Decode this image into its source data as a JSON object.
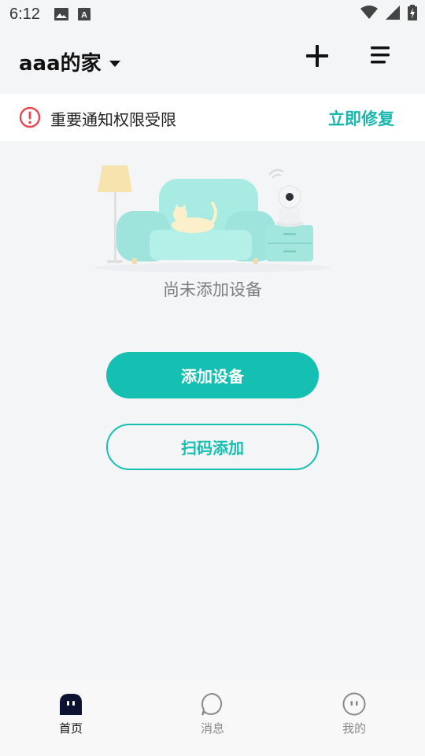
{
  "status_bar": {
    "time": "6:12",
    "icons": [
      "image-icon",
      "text-a-icon",
      "wifi-icon",
      "signal-icon",
      "battery-charging-icon"
    ]
  },
  "header": {
    "home_name": "aaa的家",
    "icons": [
      "caret-down-icon",
      "plus-icon",
      "menu-icon"
    ]
  },
  "notice": {
    "message": "重要通知权限受限",
    "action": "立即修复",
    "icon": "alert-circle-icon"
  },
  "empty_state": {
    "text": "尚未添加设备"
  },
  "actions": {
    "add_device": "添加设备",
    "scan_add": "扫码添加"
  },
  "bottom_nav": {
    "items": [
      {
        "label": "首页",
        "icon": "home-icon",
        "active": true
      },
      {
        "label": "消息",
        "icon": "message-icon",
        "active": false
      },
      {
        "label": "我的",
        "icon": "profile-icon",
        "active": false
      }
    ]
  },
  "colors": {
    "accent": "#15bfb2",
    "alert": "#e8484f",
    "background": "#f4f5f7",
    "sofa": "#9ee3dc"
  }
}
